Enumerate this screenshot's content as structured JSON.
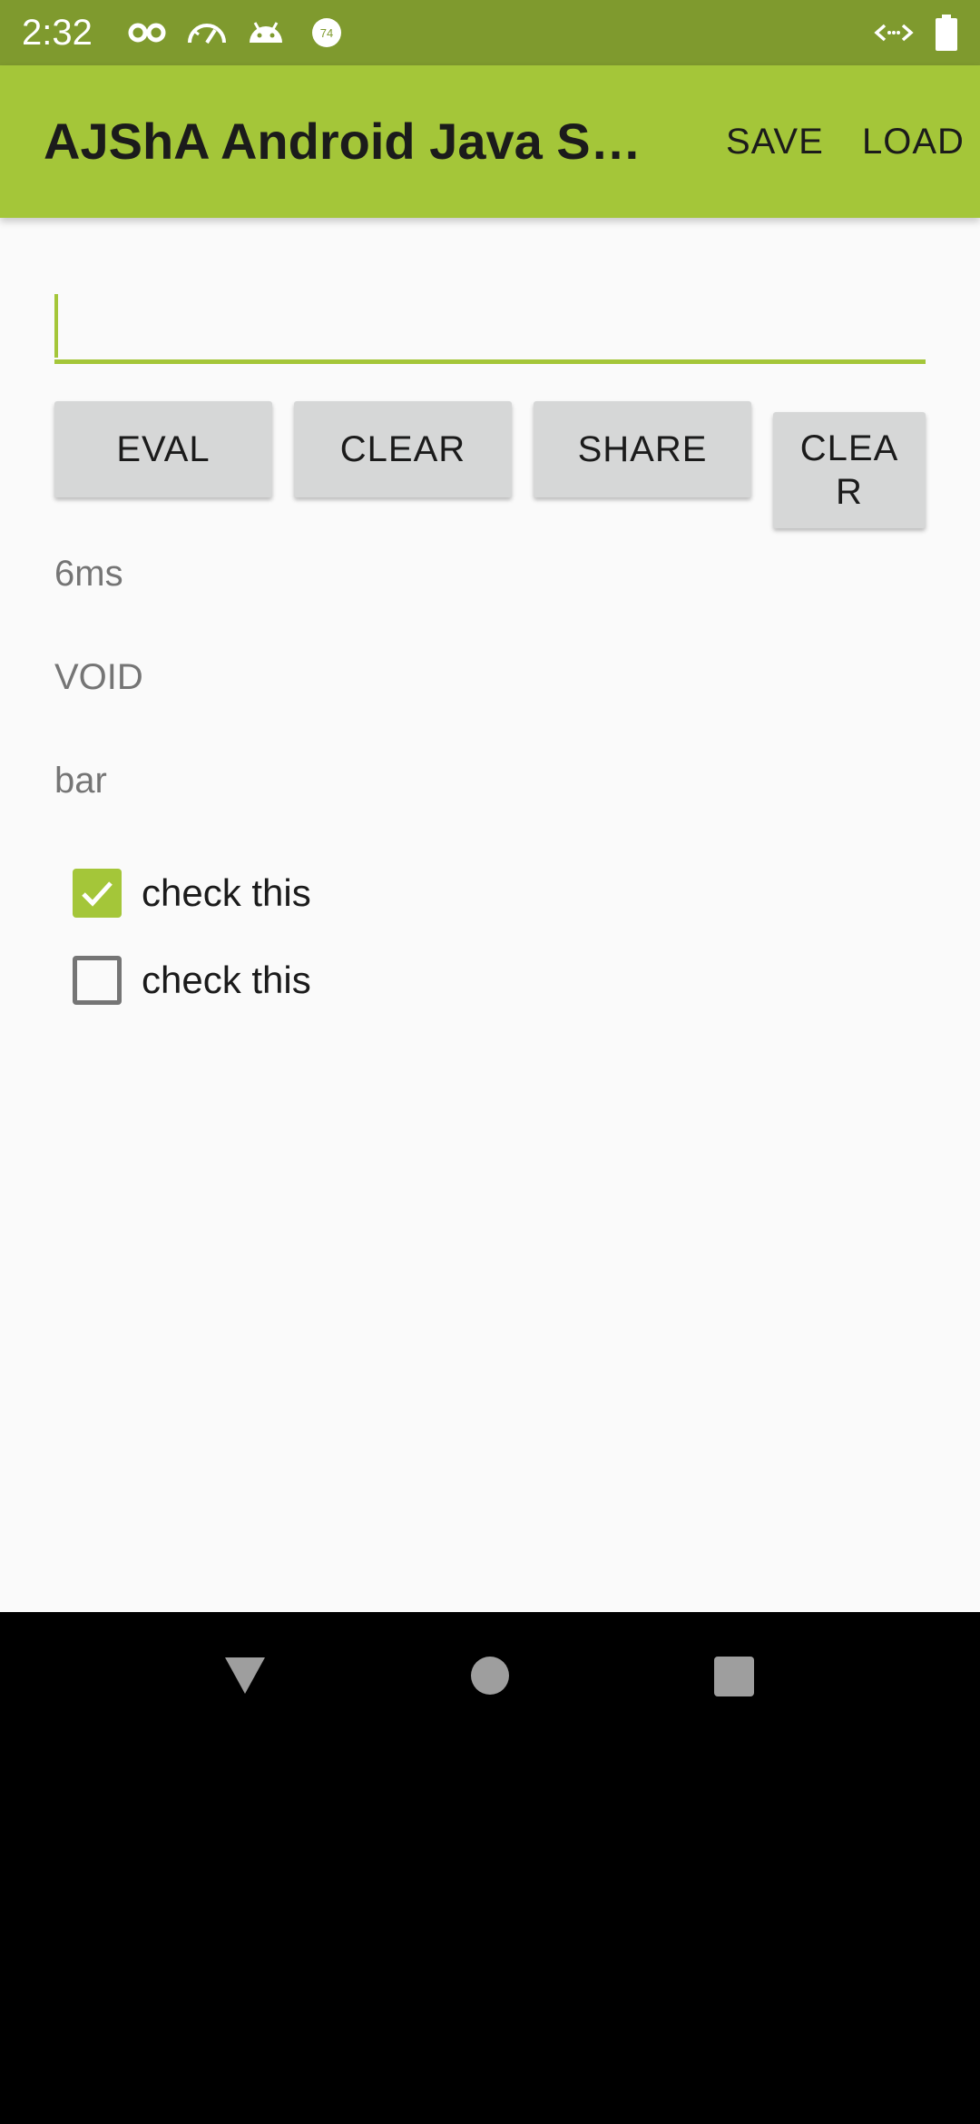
{
  "status_bar": {
    "time": "2:32",
    "left_icons": [
      "incognito-icon",
      "speedometer-icon",
      "android-icon",
      "notification-74-icon"
    ],
    "notification_badge": "74",
    "right_icons": [
      "data-saver-icon",
      "battery-icon"
    ]
  },
  "toolbar": {
    "title": "AJShA Android Java Sh…",
    "actions": [
      "SAVE",
      "LOAD"
    ]
  },
  "editor": {
    "value": "",
    "placeholder": ""
  },
  "buttons": {
    "eval": "EVAL",
    "clear": "CLEAR",
    "share": "SHARE",
    "clear2": "CLEA R"
  },
  "output": {
    "timing": "6ms",
    "result_type": "VOID",
    "result_value": "bar"
  },
  "checkboxes": [
    {
      "label": "check this",
      "checked": true
    },
    {
      "label": "check this",
      "checked": false
    }
  ],
  "navigation": [
    "back-icon",
    "home-icon",
    "recents-icon"
  ],
  "colors": {
    "accent": "#a4c639",
    "status_bar": "#7f9a2e",
    "button": "#d6d7d7",
    "background": "#fafafa"
  }
}
